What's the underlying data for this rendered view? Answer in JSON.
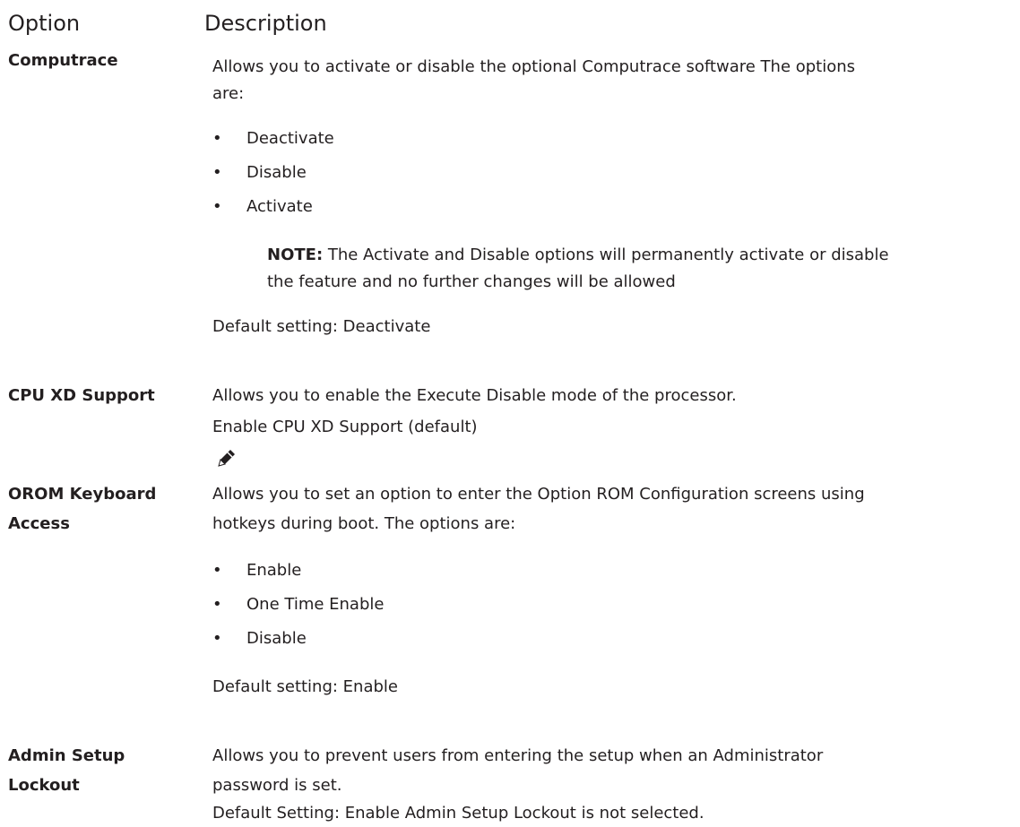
{
  "header": {
    "option": "Option",
    "description": "Description"
  },
  "rows": [
    {
      "name": "Computrace",
      "desc": [
        "Allows you to activate or disable the optional Computrace software The options",
        "are:"
      ],
      "options": [
        "Deactivate",
        "Disable",
        "Activate"
      ],
      "note_label": "NOTE:",
      "note_lines": [
        " The Activate and Disable options will permanently activate or disable",
        "the feature and no further changes will be allowed"
      ],
      "default": "Default setting: Deactivate"
    },
    {
      "name": "CPU XD Support",
      "desc": [
        "Allows you to enable the Execute Disable mode of the processor.",
        "Enable CPU XD Support (default)"
      ]
    },
    {
      "name_lines": [
        "OROM Keyboard",
        "Access"
      ],
      "desc": [
        "Allows you to set an option to enter the Option ROM Configuration screens using",
        "hotkeys during boot. The options are:"
      ],
      "options": [
        "Enable",
        "One Time Enable",
        "Disable"
      ],
      "default": "Default setting: Enable"
    },
    {
      "name_lines": [
        "Admin Setup",
        "Lockout"
      ],
      "desc": [
        "Allows you to prevent users from entering the setup when an Administrator",
        "password is set.",
        "Default Setting: Enable Admin Setup Lockout is not selected."
      ]
    }
  ],
  "icons": {
    "note": "pencil-icon"
  }
}
